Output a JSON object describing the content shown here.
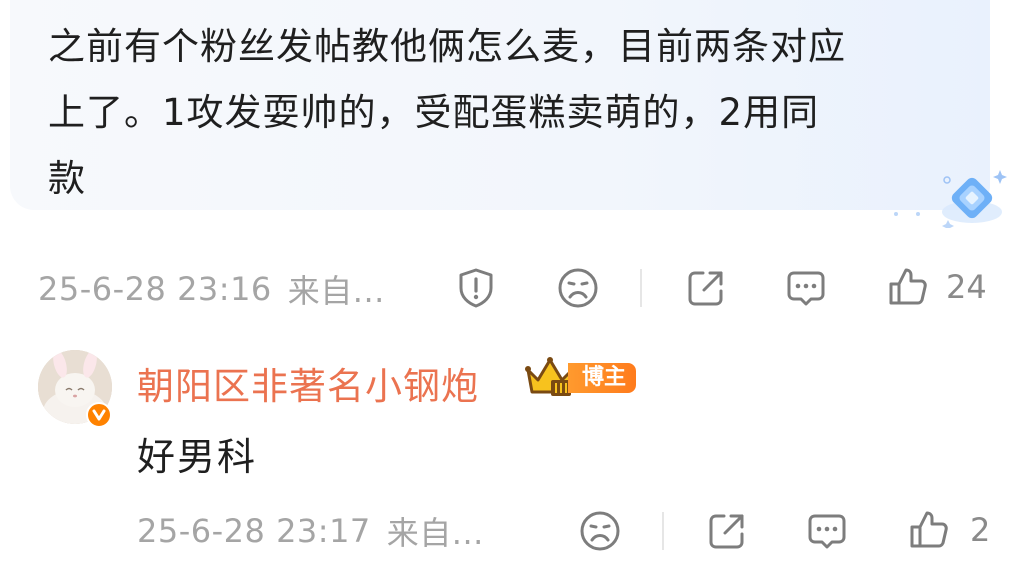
{
  "top_comment": {
    "lines": [
      "之前有个粉丝发帖教他俩怎么麦，目前两条对应",
      "上了。1攻发耍帅的，受配蛋糕卖萌的，2用同",
      "款"
    ],
    "timestamp": "25-6-28 23:16",
    "source": "来自...",
    "likes": "24"
  },
  "reply": {
    "username": "朝阳区非著名小钢炮",
    "owner_badge": "博主",
    "text": "好男科",
    "timestamp": "25-6-28 23:17",
    "source": "来自...",
    "likes": "2"
  },
  "colors": {
    "username": "#eb7350",
    "meta_text": "#a5a5a5",
    "badge_orange": "#ff8200",
    "bubble_bg": "#f2f6fc"
  },
  "icons": {
    "report": "report-icon",
    "dislike": "sad-face-icon",
    "share": "share-icon",
    "reply": "comment-icon",
    "like": "thumbs-up-icon",
    "crown": "crown-icon",
    "verified": "verified-badge-icon",
    "decoration": "diamond-sparkle-icon"
  }
}
